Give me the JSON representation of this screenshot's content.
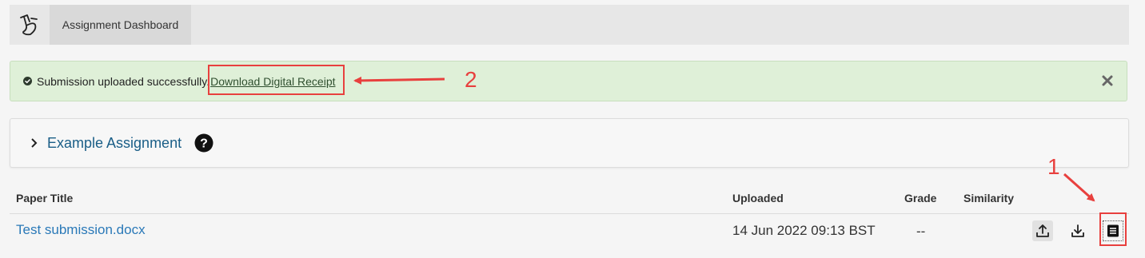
{
  "header": {
    "logo_icon": "turnitin-feedback-studio-logo-icon",
    "dashboard_tab_label": "Assignment Dashboard"
  },
  "alert": {
    "message": "Submission uploaded successfully.",
    "link_label": "Download Digital Receipt",
    "status_icon": "check-circle-icon",
    "close_icon": "close-icon",
    "background_color": "#dff0d8"
  },
  "assignment": {
    "title": "Example Assignment",
    "expand_icon": "chevron-right-icon",
    "help_icon": "question-circle-icon",
    "title_color": "#1a5e87"
  },
  "table": {
    "headers": {
      "paper_title": "Paper Title",
      "uploaded": "Uploaded",
      "grade": "Grade",
      "similarity": "Similarity"
    },
    "rows": [
      {
        "paper_title": "Test submission.docx",
        "uploaded": "14 Jun 2022 09:13 BST",
        "grade": "--",
        "similarity": "",
        "actions": [
          "upload-icon",
          "download-icon",
          "digital-receipt-icon"
        ]
      }
    ]
  },
  "annotations": [
    {
      "number": "1",
      "color": "#e8403e"
    },
    {
      "number": "2",
      "color": "#e8403e"
    }
  ]
}
